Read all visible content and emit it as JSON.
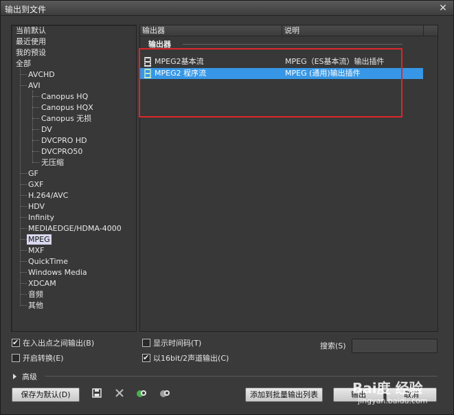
{
  "window": {
    "title": "输出到文件",
    "close_glyph": "✕"
  },
  "tree": {
    "top_items": [
      "当前默认",
      "最近使用",
      "我的预设",
      "全部"
    ],
    "formats": [
      "AVCHD",
      "AVI"
    ],
    "avi_children": [
      "Canopus HQ",
      "Canopus HQX",
      "Canopus 无损",
      "DV",
      "DVCPRO HD",
      "DVCPRO50",
      "无压缩"
    ],
    "more_formats": [
      "GF",
      "GXF",
      "H.264/AVC",
      "HDV",
      "Infinity",
      "MEDIAEDGE/HDMA-4000",
      "MPEG",
      "MXF",
      "QuickTime",
      "Windows Media",
      "XDCAM",
      "音频",
      "其他"
    ],
    "selected": "MPEG"
  },
  "list": {
    "columns": [
      "输出器",
      "说明"
    ],
    "group_title": "输出器",
    "rows": [
      {
        "name": "MPEG2基本流",
        "desc": "MPEG（ES基本流）输出插件",
        "selected": false
      },
      {
        "name": "MPEG2 程序流",
        "desc": "MPEG (通用)输出插件",
        "selected": true
      }
    ]
  },
  "options": {
    "in_out": {
      "label": "在入出点之间输出(B)",
      "checked": true
    },
    "show_timecode": {
      "label": "显示时间码(T)",
      "checked": false
    },
    "enable_convert": {
      "label": "开启转换(E)",
      "checked": false
    },
    "audio_16bit": {
      "label": "以16bit/2声道输出(C)",
      "checked": true
    },
    "search_label": "搜索(S)",
    "search_value": ""
  },
  "advanced": {
    "label": "高级"
  },
  "buttons": {
    "save_default": "保存为默认(D)",
    "add_batch": "添加到批量输出列表",
    "output": "输出",
    "cancel": "取消"
  },
  "watermark": {
    "brand": "Bai度 经验",
    "url": "jingyan.baidu.com"
  },
  "colors": {
    "selection": "#3797e6",
    "highlight_box": "#e0262b",
    "tree_selected": "#d8d8ee"
  }
}
